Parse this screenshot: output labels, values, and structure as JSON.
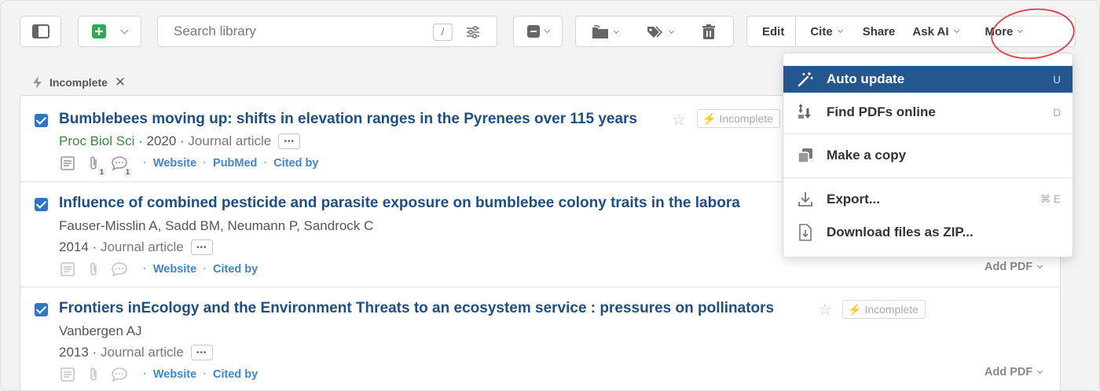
{
  "toolbar": {
    "search_placeholder": "Search library",
    "search_shortcut": "/",
    "edit": "Edit",
    "cite": "Cite",
    "share": "Share",
    "ask_ai": "Ask AI",
    "more": "More"
  },
  "filter": {
    "label": "Incomplete"
  },
  "items": [
    {
      "title": "Bumblebees moving up: shifts in elevation ranges in the Pyrenees over 115 years",
      "badge": "Incomplete",
      "journal": "Proc Biol Sci",
      "year": "2020",
      "type": "Journal article",
      "attach_count": "1",
      "note_count": "1",
      "links": [
        "Website",
        "PubMed",
        "Cited by"
      ]
    },
    {
      "title": "Influence of combined pesticide and parasite exposure on bumblebee colony traits in the labora",
      "authors": "Fauser-Misslin A, Sadd BM, Neumann P, Sandrock C",
      "year": "2014",
      "type": "Journal article",
      "links": [
        "Website",
        "Cited by"
      ],
      "add_pdf": "Add PDF"
    },
    {
      "title": "Frontiers inEcology and the Environment Threats to an ecosystem service : pressures on pollinators",
      "badge": "Incomplete",
      "authors": "Vanbergen AJ",
      "year": "2013",
      "type": "Journal article",
      "links": [
        "Website",
        "Cited by"
      ],
      "add_pdf": "Add PDF"
    }
  ],
  "menu": {
    "items": [
      {
        "label": "Auto update",
        "shortcut": "U",
        "icon": "magic-wand-icon",
        "active": true
      },
      {
        "label": "Find PDFs online",
        "shortcut": "D",
        "icon": "find-pdf-icon"
      },
      {
        "label": "Make a copy",
        "icon": "copy-icon"
      },
      {
        "label": "Export...",
        "shortcut": "⌘ E",
        "icon": "export-icon"
      },
      {
        "label": "Download files as ZIP...",
        "icon": "zip-file-icon"
      }
    ]
  },
  "colors": {
    "accent": "#24578f",
    "title": "#1d4f84",
    "link": "#3d87d2",
    "journal": "#3b8a3b",
    "checkbox": "#2f75c4",
    "annotation_ring": "#e3464d"
  }
}
